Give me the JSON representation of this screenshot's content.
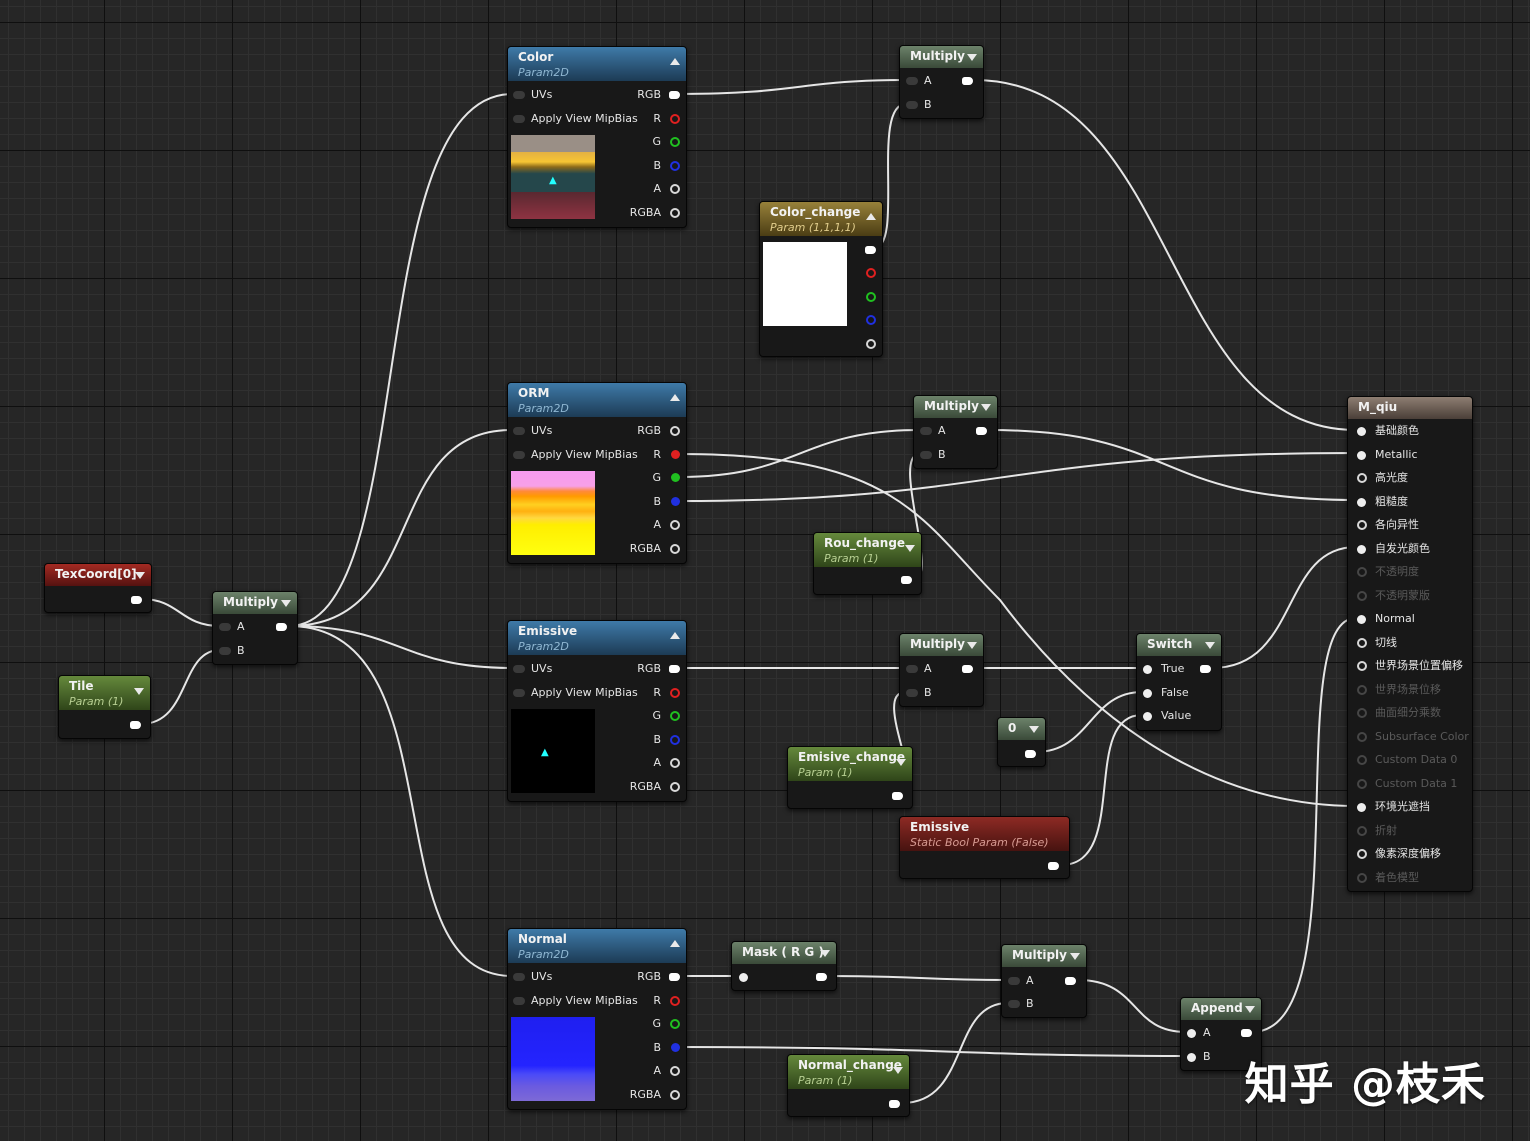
{
  "texcoord": {
    "title": "TexCoord[0]"
  },
  "tile": {
    "title": "Tile",
    "sub": "Param (1)"
  },
  "mul_uv": {
    "title": "Multiply",
    "a": "A",
    "b": "B"
  },
  "color_tex": {
    "title": "Color",
    "sub": "Param2D",
    "uvs": "UVs",
    "mip": "Apply View MipBias",
    "out": [
      "RGB",
      "R",
      "G",
      "B",
      "A",
      "RGBA"
    ]
  },
  "orm_tex": {
    "title": "ORM",
    "sub": "Param2D",
    "uvs": "UVs",
    "mip": "Apply View MipBias",
    "out": [
      "RGB",
      "R",
      "G",
      "B",
      "A",
      "RGBA"
    ]
  },
  "emissive_tex": {
    "title": "Emissive",
    "sub": "Param2D",
    "uvs": "UVs",
    "mip": "Apply View MipBias",
    "out": [
      "RGB",
      "R",
      "G",
      "B",
      "A",
      "RGBA"
    ]
  },
  "normal_tex": {
    "title": "Normal",
    "sub": "Param2D",
    "uvs": "UVs",
    "mip": "Apply View MipBias",
    "out": [
      "RGB",
      "R",
      "G",
      "B",
      "A",
      "RGBA"
    ]
  },
  "color_change": {
    "title": "Color_change",
    "sub": "Param (1,1,1,1)"
  },
  "mul_color": {
    "title": "Multiply",
    "a": "A",
    "b": "B"
  },
  "mul_rough": {
    "title": "Multiply",
    "a": "A",
    "b": "B"
  },
  "rou_change": {
    "title": "Rou_change",
    "sub": "Param (1)"
  },
  "mul_emis": {
    "title": "Multiply",
    "a": "A",
    "b": "B"
  },
  "emis_change": {
    "title": "Emisive_change",
    "sub": "Param (1)"
  },
  "const0": {
    "title": "0"
  },
  "switch": {
    "title": "Switch",
    "true": "True",
    "false": "False",
    "value": "Value"
  },
  "emis_bool": {
    "title": "Emissive",
    "sub": "Static Bool Param (False)"
  },
  "mask": {
    "title": "Mask ( R G )"
  },
  "mul_normal": {
    "title": "Multiply",
    "a": "A",
    "b": "B"
  },
  "normal_change": {
    "title": "Normal_change",
    "sub": "Param (1)"
  },
  "append": {
    "title": "Append",
    "a": "A",
    "b": "B"
  },
  "material": {
    "title": "M_qiu",
    "inputs": [
      {
        "label": "基础颜色",
        "active": true
      },
      {
        "label": "Metallic",
        "active": true
      },
      {
        "label": "高光度",
        "active": true
      },
      {
        "label": "粗糙度",
        "active": true
      },
      {
        "label": "各向异性",
        "active": true
      },
      {
        "label": "自发光颜色",
        "active": true
      },
      {
        "label": "不透明度",
        "active": false
      },
      {
        "label": "不透明蒙版",
        "active": false
      },
      {
        "label": "Normal",
        "active": true
      },
      {
        "label": "切线",
        "active": true
      },
      {
        "label": "世界场景位置偏移",
        "active": true
      },
      {
        "label": "世界场景位移",
        "active": false
      },
      {
        "label": "曲面细分乘数",
        "active": false
      },
      {
        "label": "Subsurface Color",
        "active": false
      },
      {
        "label": "Custom Data 0",
        "active": false
      },
      {
        "label": "Custom Data 1",
        "active": false
      },
      {
        "label": "环境光遮挡",
        "active": true
      },
      {
        "label": "折射",
        "active": false
      },
      {
        "label": "像素深度偏移",
        "active": true
      },
      {
        "label": "着色模型",
        "active": false
      }
    ]
  },
  "watermark": "知乎 @枝禾",
  "colors": {
    "wire": "#e6e6e6",
    "pin_r": "#e02020",
    "pin_g": "#20c020",
    "pin_b": "#2030e0"
  }
}
